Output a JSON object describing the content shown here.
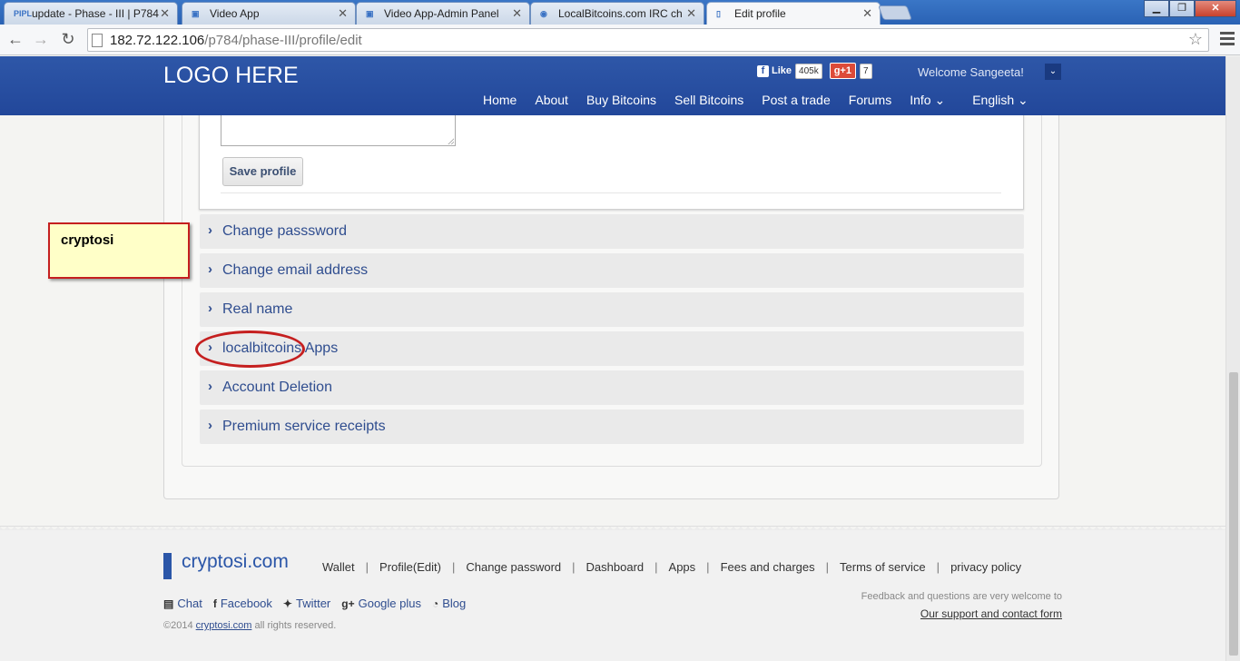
{
  "browser": {
    "tabs": [
      {
        "favicon": "PIPL",
        "title": "update - Phase - III | P784"
      },
      {
        "favicon": "video-app-icon",
        "title": "Video App"
      },
      {
        "favicon": "video-app-icon",
        "title": "Video App-Admin Panel"
      },
      {
        "favicon": "localbitcoins-icon",
        "title": "LocalBitcoins.com IRC ch"
      },
      {
        "favicon": "page-icon",
        "title": "Edit profile"
      }
    ],
    "url_host": "182.72.122.106",
    "url_path": "/p784/phase-III/profile/edit"
  },
  "header": {
    "logo": "LOGO HERE",
    "fb_like": "Like",
    "fb_count": "405k",
    "gplus_label": "g+1",
    "gplus_count": "7",
    "welcome": "Welcome Sangeeta!",
    "nav": [
      "Home",
      "About",
      "Buy Bitcoins",
      "Sell Bitcoins",
      "Post a trade",
      "Forums",
      "Info",
      "English"
    ]
  },
  "form": {
    "save_label": "Save profile"
  },
  "accordion": [
    "Change passsword",
    "Change email address",
    "Real name",
    "localbitcoins Apps",
    "Account Deletion",
    "Premium service receipts"
  ],
  "annotation": {
    "note_text": "cryptosi",
    "note_color": "#ffffc8",
    "highlight_color": "#c51f1f"
  },
  "footer": {
    "brand": "cryptosi.com",
    "links": [
      "Wallet",
      "Profile(Edit)",
      "Change password",
      "Dashboard",
      "Apps",
      "Fees and charges",
      "Terms of service",
      "privacy policy"
    ],
    "social": [
      "Chat",
      "Facebook",
      "Twitter",
      "Google plus",
      "Blog"
    ],
    "copyright_prefix": "©2014",
    "copyright_link": "cryptosi.com",
    "copyright_suffix": "all rights reserved.",
    "feedback": "Feedback and questions are very welcome to",
    "support": "Our support and contact form"
  },
  "colors": {
    "header_blue": "#2e57a8",
    "link_blue": "#2f4d8f"
  }
}
